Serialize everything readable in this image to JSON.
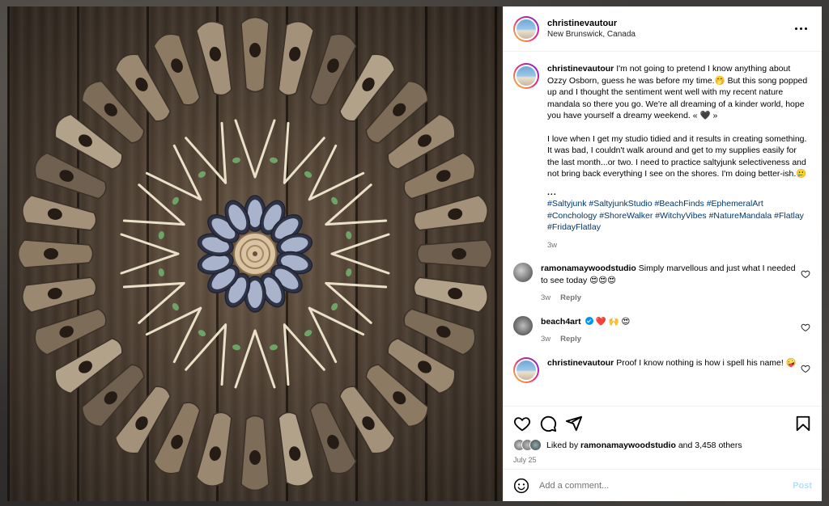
{
  "post": {
    "username": "christinevautour",
    "location": "New Brunswick, Canada"
  },
  "caption": {
    "username": "christinevautour",
    "para1": "I'm not going to pretend I know anything about Ozzy Osborn, guess he was before my time.🤭 But this song popped up and I thought the sentiment went well with my recent nature mandala so there you go. We're all dreaming of a kinder world, hope you have yourself a dreamy weekend. « 🖤 »",
    "para2": "I love when I get my studio tidied and it results in creating something. It was bad, I couldn't walk around and get to my supplies easily for the last month...or two. I need to practice saltyjunk selectiveness and not bring back everything I see on the shores. I'm doing better-ish.🥲",
    "ellipsis": "...",
    "hashtags": "#Saltyjunk #SaltyjunkStudio #BeachFinds #EphemeralArt #Conchology #ShoreWalker #WitchyVibes #NatureMandala #Flatlay #FridayFlatlay",
    "time": "3w"
  },
  "comments": [
    {
      "username": "ramonamaywoodstudio",
      "text": "Simply marvellous and just what I needed to see today 😍😍😍",
      "time": "3w",
      "reply": "Reply"
    },
    {
      "username": "beach4art",
      "text": "❤️ 🙌 😍",
      "time": "3w",
      "reply": "Reply"
    },
    {
      "username": "christinevautour",
      "text": "Proof I know nothing is how i spell his name! 🤪"
    }
  ],
  "likes": {
    "prefix": "Liked by",
    "user": "ramonamaywoodstudio",
    "rest": "and 3,458 others"
  },
  "date": "July 25",
  "add_comment": {
    "placeholder": "Add a comment...",
    "post_label": "Post"
  },
  "icons": {
    "header_more": "more-horizontal-icon",
    "like": "heart-icon",
    "comment": "comment-icon",
    "share": "send-icon",
    "save": "bookmark-icon",
    "emoji": "emoji-icon"
  },
  "colors": {
    "link": "#00376b",
    "post_disabled": "#b2dffc",
    "verified": "#0095f6"
  }
}
